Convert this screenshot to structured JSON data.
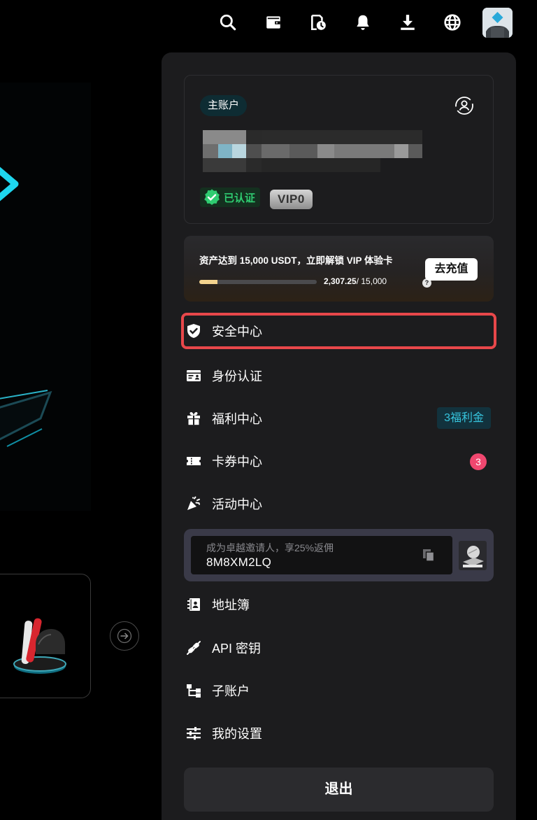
{
  "account": {
    "main_badge": "主账户",
    "verified_label": "已认证",
    "vip_label": "VIP0"
  },
  "promo": {
    "text": "资产达到 15,000 USDT，立即解锁 VIP 体验卡",
    "progress_current": "2,307.25",
    "progress_target": "/ 15,000",
    "progress_fraction": 0.154,
    "help": "?",
    "button_label": "去充值"
  },
  "menu": {
    "security": "安全中心",
    "identity": "身份认证",
    "benefits": "福利中心",
    "benefits_tag": "3福利金",
    "coupons": "卡券中心",
    "coupons_count": "3",
    "activities": "活动中心",
    "address_book": "地址簿",
    "api_keys": "API 密钥",
    "sub_accounts": "子账户",
    "settings": "我的设置"
  },
  "invite": {
    "hint": "成为卓越邀请人，享25%返佣",
    "code": "8M8XM2LQ"
  },
  "logout_label": "退出",
  "colors": {
    "panel_bg": "#1c1c1e",
    "highlight_border": "#e8474a",
    "verified_green": "#2fcc71",
    "bonus_cyan": "#37c6df",
    "badge_pink": "#f0476f",
    "progress_gold": "#f3d38e"
  },
  "icons": {
    "topbar": [
      "search-icon",
      "wallet-icon",
      "history-icon",
      "bell-icon",
      "download-icon",
      "globe-icon"
    ]
  }
}
